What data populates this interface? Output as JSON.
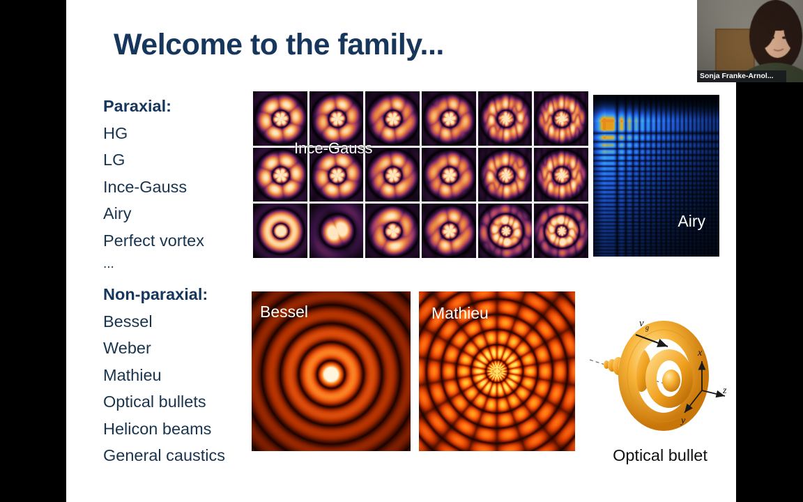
{
  "slide": {
    "title": "Welcome to the family...",
    "title_color": "#16365c",
    "background": "#ffffff",
    "letterbox_color": "#000000"
  },
  "paraxial": {
    "heading": "Paraxial:",
    "items": [
      "HG",
      "LG",
      "Ince-Gauss",
      "Airy",
      "Perfect vortex",
      "..."
    ]
  },
  "nonparaxial": {
    "heading": "Non-paraxial:",
    "items": [
      "Bessel",
      "Weber",
      "Mathieu",
      "Optical bullets",
      "Helicon beams",
      "General caustics"
    ]
  },
  "figures": {
    "ince_gauss": {
      "label": "Ince-Gauss",
      "columns": 6,
      "rows": 3,
      "cell_background": "#050308",
      "palette": [
        "#000000",
        "#3a1446",
        "#a03a6a",
        "#e2733a",
        "#f7b46a",
        "#ffe6c0"
      ]
    },
    "airy": {
      "label": "Airy",
      "background": "#000205",
      "palette": [
        "#000205",
        "#10307e",
        "#2060e0",
        "#35a0f0",
        "#e8b020",
        "#e03010"
      ]
    },
    "bessel": {
      "label": "Bessel",
      "background": "#1a0600",
      "palette": [
        "#120300",
        "#5a1200",
        "#b03000",
        "#f05a10",
        "#ff9a30",
        "#fff4dc"
      ]
    },
    "mathieu": {
      "label": "Mathieu",
      "background": "#1a0600",
      "palette": [
        "#150200",
        "#6a1600",
        "#d03800",
        "#ff6a10",
        "#ffb020",
        "#ffe870"
      ]
    },
    "optical_bullet": {
      "caption": "Optical bullet",
      "velocity_label": "v",
      "velocity_subscript": "g",
      "axes": [
        "x",
        "y",
        "z"
      ],
      "color": "#f5a623"
    }
  },
  "webcam": {
    "participant_name": "Sonja Franke-Arnol...",
    "name_bar_color": "#14161c"
  }
}
